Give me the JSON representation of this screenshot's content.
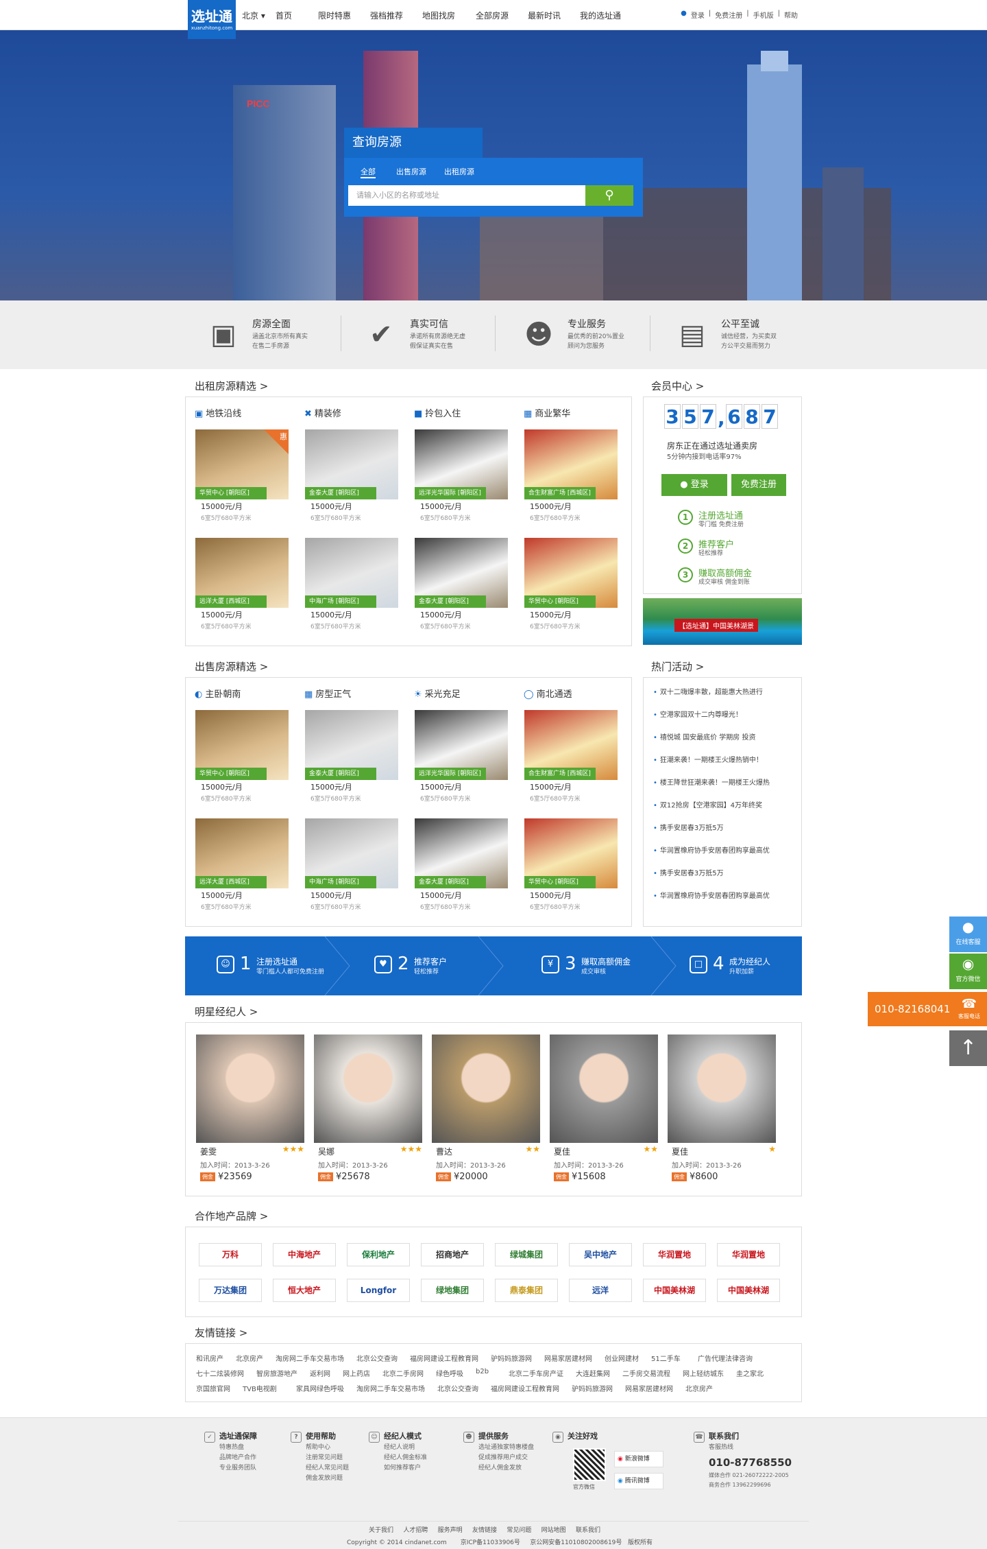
{
  "logo": {
    "title": "选址通",
    "sub": "xuanzhitong.com"
  },
  "city": "北京 ▾",
  "nav": [
    "首页",
    "限时特惠",
    "强档推荐",
    "地图找房",
    "全部房源",
    "最新时讯",
    "我的选址通"
  ],
  "toplinks": [
    "登录",
    "免费注册",
    "手机版",
    "帮助"
  ],
  "hero": {
    "building_sign": "PICC"
  },
  "search": {
    "title": "查询房源",
    "tabs": [
      "全部",
      "出售房源",
      "出租房源"
    ],
    "placeholder": "请输入小区的名称或地址"
  },
  "features": [
    {
      "title": "房源全面",
      "desc": [
        "涵盖北京市所有真实",
        "在售二手房源"
      ],
      "icon": "map-icon"
    },
    {
      "title": "真实可信",
      "desc": [
        "承诺所有房源绝无虚",
        "假保证真实在售"
      ],
      "icon": "check-badge-icon"
    },
    {
      "title": "专业服务",
      "desc": [
        "最优秀的前20%置业",
        "顾问为您服务"
      ],
      "icon": "people-icon"
    },
    {
      "title": "公平至诚",
      "desc": [
        "诚信经营，为买卖双",
        "方公平交易而努力"
      ],
      "icon": "briefcase-icon"
    }
  ],
  "rent": {
    "title": "出租房源精选 >",
    "categories": [
      "地铁沿线",
      "精装修",
      "拎包入住",
      "商业繁华"
    ],
    "cards": [
      {
        "label": "华贸中心 [朝阳区]",
        "price": "15000元/月",
        "size": "6室5厅680平方米",
        "badge": "惠"
      },
      {
        "label": "金泰大厦 [朝阳区]",
        "price": "15000元/月",
        "size": "6室5厅680平方米"
      },
      {
        "label": "远洋光华国际 [朝阳区]",
        "price": "15000元/月",
        "size": "6室5厅680平方米"
      },
      {
        "label": "合生财富广场 [西城区]",
        "price": "15000元/月",
        "size": "6室5厅680平方米"
      },
      {
        "label": "远洋大厦 [西城区]",
        "price": "15000元/月",
        "size": "6室5厅680平方米"
      },
      {
        "label": "中海广场 [朝阳区]",
        "price": "15000元/月",
        "size": "6室5厅680平方米"
      },
      {
        "label": "金泰大厦 [朝阳区]",
        "price": "15000元/月",
        "size": "6室5厅680平方米"
      },
      {
        "label": "华贸中心 [朝阳区]",
        "price": "15000元/月",
        "size": "6室5厅680平方米"
      }
    ]
  },
  "sale": {
    "title": "出售房源精选 >",
    "categories": [
      "主卧朝南",
      "房型正气",
      "采光充足",
      "南北通透"
    ],
    "cards": [
      {
        "label": "华贸中心 [朝阳区]",
        "price": "15000元/月",
        "size": "6室5厅680平方米"
      },
      {
        "label": "金泰大厦 [朝阳区]",
        "price": "15000元/月",
        "size": "6室5厅680平方米"
      },
      {
        "label": "远洋光华国际 [朝阳区]",
        "price": "15000元/月",
        "size": "6室5厅680平方米"
      },
      {
        "label": "合生财富广场 [西城区]",
        "price": "15000元/月",
        "size": "6室5厅680平方米"
      },
      {
        "label": "远洋大厦 [西城区]",
        "price": "15000元/月",
        "size": "6室5厅680平方米"
      },
      {
        "label": "中海广场 [朝阳区]",
        "price": "15000元/月",
        "size": "6室5厅680平方米"
      },
      {
        "label": "金泰大厦 [朝阳区]",
        "price": "15000元/月",
        "size": "6室5厅680平方米"
      },
      {
        "label": "华贸中心 [朝阳区]",
        "price": "15000元/月",
        "size": "6室5厅680平方米"
      }
    ]
  },
  "member": {
    "title": "会员中心 >",
    "count_digits": [
      "3",
      "5",
      "7",
      ",",
      "6",
      "8",
      "7"
    ],
    "line1": "房东正在通过选址通卖房",
    "line2": "5分钟内接到电话率97%",
    "login": "登录",
    "register": "免费注册",
    "steps": [
      {
        "n": "1",
        "t": "注册选址通",
        "s": "零门槛 免费注册"
      },
      {
        "n": "2",
        "t": "推荐客户",
        "s": "轻松推荐"
      },
      {
        "n": "3",
        "t": "赚取高额佣金",
        "s": "成交审核 佣金到账"
      }
    ],
    "banner": "【选址通】中国美林湖景"
  },
  "hot": {
    "title": "热门活动 >",
    "items": [
      "双十二嗨爆丰散，超能惠大热进行",
      "空港家园双十二内尊曝光！",
      "禧悦城 国安最底价 学期房 投资",
      "狂潮来袭！一期楼王火爆热销中！",
      "楼王降世狂潮来袭！一期楼王火爆热",
      "双12抢房【空港家园】4万年终奖",
      "携手安居春3万抵5万",
      "华润置橡府协手安居春团购享最高优",
      "携手安居春3万抵5万",
      "华润置橡府协手安居春团购享最高优"
    ]
  },
  "band": [
    {
      "num": "1",
      "t": "注册选址通",
      "s": "零门槛人人都可免费注册",
      "icon": "user-icon"
    },
    {
      "num": "2",
      "t": "推荐客户",
      "s": "轻松推荐",
      "icon": "heart-icon"
    },
    {
      "num": "3",
      "t": "赚取高额佣金",
      "s": "成交审核",
      "icon": "yen-icon"
    },
    {
      "num": "4",
      "t": "成为经纪人",
      "s": "升职加薪",
      "icon": "badge-icon"
    }
  ],
  "agents": {
    "title": "明星经纪人 >",
    "list": [
      {
        "name": "姜雯",
        "stars": "★★★",
        "date": "加入时间：2013-3-26",
        "tag": "佣金",
        "amount": "¥23569"
      },
      {
        "name": "吴娜",
        "stars": "★★★",
        "date": "加入时间：2013-3-26",
        "tag": "佣金",
        "amount": "¥25678"
      },
      {
        "name": "曹达",
        "stars": "★★",
        "date": "加入时间：2013-3-26",
        "tag": "佣金",
        "amount": "¥20000"
      },
      {
        "name": "夏佳",
        "stars": "★★",
        "date": "加入时间：2013-3-26",
        "tag": "佣金",
        "amount": "¥15608"
      },
      {
        "name": "夏佳",
        "stars": "★",
        "date": "加入时间：2013-3-26",
        "tag": "佣金",
        "amount": "¥8600"
      }
    ]
  },
  "brands": {
    "title": "合作地产品牌 >",
    "list": [
      "万科",
      "中海地产",
      "保利地产",
      "招商地产",
      "绿城集团",
      "吴中地产",
      "华润置地",
      "华润置地",
      "万达集团",
      "恒大地产",
      "Longfor",
      "绿地集团",
      "鼎泰集团",
      "远洋",
      "中国美林湖",
      "中国美林湖"
    ],
    "colors": [
      "#c8161d",
      "#c8161d",
      "#1a7c3b",
      "#333333",
      "#2f7d32",
      "#1e4ea1",
      "#c8161d",
      "#c8161d",
      "#1e4ea1",
      "#c8161d",
      "#1e4ea1",
      "#2f7d32",
      "#c59a1e",
      "#1e4ea1",
      "#c8161d",
      "#c8161d"
    ]
  },
  "links": {
    "title": "友情链接 >",
    "rows": [
      [
        "和讯房产",
        "北京房产",
        "淘房网二手车交易市场",
        "北京公交查询",
        "福房网建设工程教育网",
        "驴妈妈旅游网",
        "网易家居建材网",
        "创业网建材",
        "51二手车",
        "广告代理法律咨询"
      ],
      [
        "七十二炫装修网",
        "智房旅游地产",
        "返利网",
        "网上药店",
        "北京二手房网",
        "绿色呼吸",
        "b2b",
        "北京二手车房产证",
        "大连赶集网",
        "二手房交易流程",
        "网上轻纺城东",
        "圭之家北"
      ],
      [
        "京国旅官网",
        "TVB电视剧",
        "家具网绿色呼吸",
        "淘房网二手车交易市场",
        "北京公交查询",
        "福房网建设工程教育网",
        "驴妈妈旅游网",
        "网易家居建材网",
        "北京房产"
      ]
    ]
  },
  "footer": {
    "cols": [
      {
        "h": "选址通保障",
        "icon": "shield-icon",
        "items": [
          "特惠热盘",
          "品牌地产合作",
          "专业服务团队"
        ]
      },
      {
        "h": "使用帮助",
        "icon": "question-icon",
        "items": [
          "帮助中心",
          "注册常见问题",
          "经纪人常见问题",
          "佣金发放问题"
        ]
      },
      {
        "h": "经纪人模式",
        "icon": "person-icon",
        "items": [
          "经纪人说明",
          "经纪人佣金标准",
          "如何推荐客户"
        ]
      },
      {
        "h": "提供服务",
        "icon": "smile-icon",
        "items": [
          "选址通独家特惠楼盘",
          "促成推荐用户成交",
          "经纪人佣金发放"
        ]
      },
      {
        "h": "关注好戏",
        "icon": "eye-icon",
        "items": []
      },
      {
        "h": "联系我们",
        "icon": "phone-icon",
        "items": [
          "客服热线"
        ]
      }
    ],
    "qr_label": "官方微信",
    "weibo1": "新浪微博",
    "weibo2": "腾讯微博",
    "phone": "010-87768550",
    "contact1": "媒体合作 021-26072222-2005",
    "contact2": "商务合作 13962299696",
    "bottom_links": [
      "关于我们",
      "人才招聘",
      "服务声明",
      "友情链接",
      "常见问题",
      "网站地图",
      "联系我们"
    ],
    "copyright": "Copyright © 2014 cindanet.com",
    "icp": "京ICP备11033906号",
    "police": "京公网安备11010802008619号",
    "rights": "版权所有"
  },
  "side": {
    "online": "在线客服",
    "wechat": "官方微信",
    "phone_label": "客服电话",
    "phone": "010-82168041"
  }
}
